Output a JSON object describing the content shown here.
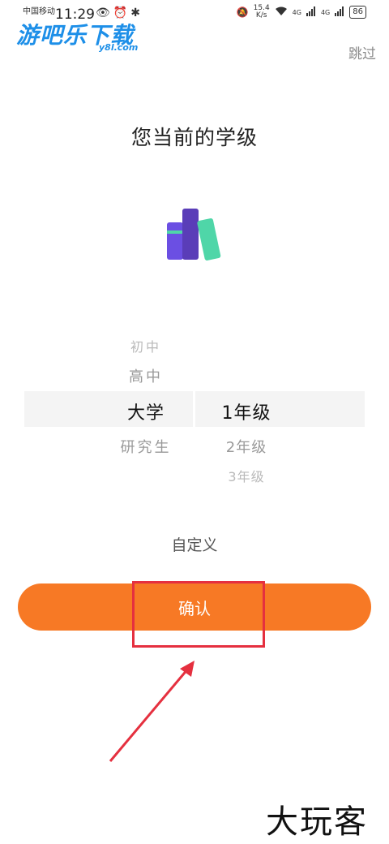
{
  "status_bar": {
    "carrier": "中国移动",
    "time": "11:29",
    "net_speed_value": "15.4",
    "net_speed_unit": "K/s",
    "signal_label_1": "4G",
    "signal_label_2": "4G",
    "battery": "86"
  },
  "watermark_logo": {
    "main": "游吧乐下载",
    "sub": "y8l.com"
  },
  "skip_label": "跳过",
  "title": "您当前的学级",
  "picker": {
    "level_options": [
      "初中",
      "高中",
      "大学",
      "研究生"
    ],
    "selected_level": "大学",
    "grade_options": [
      "1年级",
      "2年级",
      "3年级"
    ],
    "selected_grade": "1年级"
  },
  "custom_label": "自定义",
  "confirm_label": "确认",
  "watermark_bottom": "大玩客",
  "colors": {
    "accent": "#f77925",
    "annotation_red": "#e5303f",
    "book_purple": "#6b4fe3",
    "book_teal": "#4fd6a8"
  }
}
